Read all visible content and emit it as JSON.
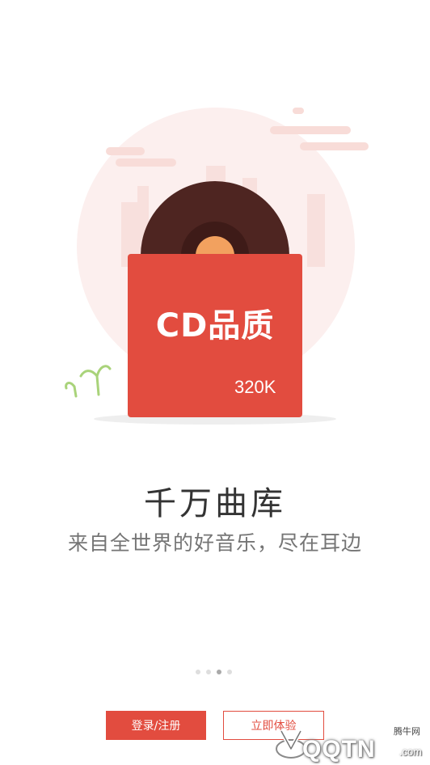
{
  "hero": {
    "album_title": "CD品质",
    "bitrate": "320K"
  },
  "headline": "千万曲库",
  "subline": "来自全世界的好音乐，尽在耳边",
  "pager": {
    "total": 4,
    "active_index": 2
  },
  "buttons": {
    "login_label": "登录/注册",
    "try_label": "立即体验"
  },
  "watermark": {
    "site_name": "腾牛网",
    "logo_text": "QQTN",
    "domain_suffix": ".com"
  },
  "colors": {
    "accent": "#e24c3f",
    "vinyl": "#4e2521",
    "vinyl_center": "#f2a15f",
    "background_circle": "#fcefee"
  }
}
